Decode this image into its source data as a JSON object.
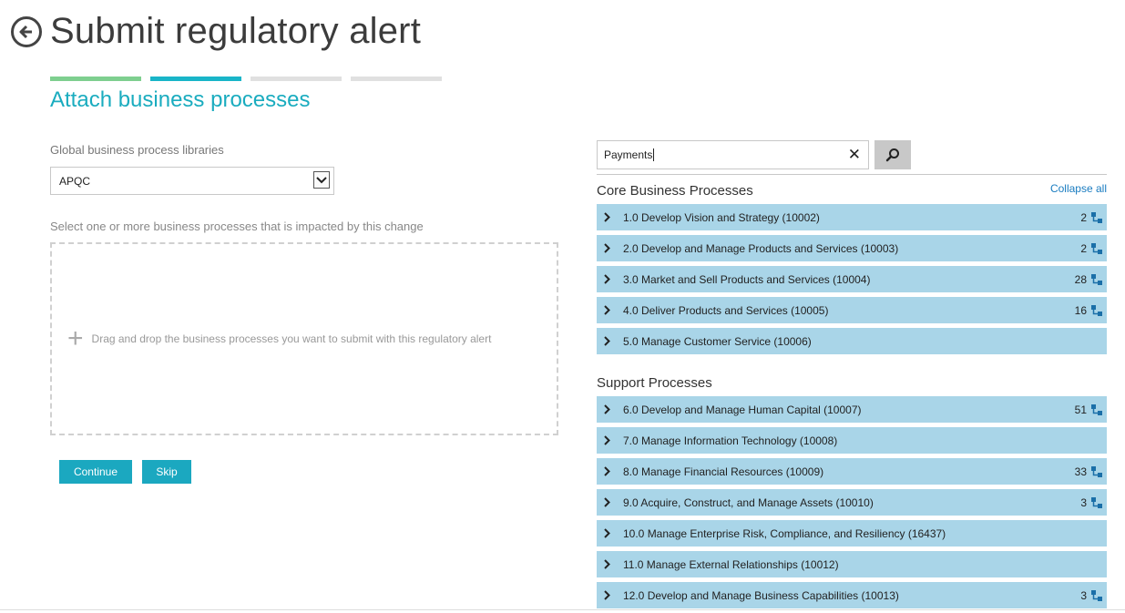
{
  "header": {
    "title": "Submit regulatory alert"
  },
  "wizard": {
    "steps": [
      "done",
      "active",
      "pending",
      "pending"
    ],
    "section_title": "Attach business processes"
  },
  "library": {
    "label": "Global business process libraries",
    "selected": "APQC"
  },
  "selection": {
    "label": "Select one or more business processes that is impacted by this change",
    "drop_text": "Drag and drop the business processes you want to submit with this regulatory alert"
  },
  "buttons": {
    "continue": "Continue",
    "skip": "Skip"
  },
  "search": {
    "value": "Payments"
  },
  "tree": {
    "collapse_all": "Collapse all",
    "groups": [
      {
        "title": "Core Business Processes",
        "items": [
          {
            "label": "1.0 Develop Vision and Strategy (10002)",
            "count": "2"
          },
          {
            "label": "2.0 Develop and Manage Products and Services (10003)",
            "count": "2"
          },
          {
            "label": "3.0 Market and Sell Products and Services (10004)",
            "count": "28"
          },
          {
            "label": "4.0 Deliver Products and Services (10005)",
            "count": "16"
          },
          {
            "label": "5.0 Manage Customer Service (10006)",
            "count": ""
          }
        ]
      },
      {
        "title": "Support Processes",
        "items": [
          {
            "label": "6.0 Develop and Manage Human Capital (10007)",
            "count": "51"
          },
          {
            "label": "7.0 Manage Information Technology (10008)",
            "count": ""
          },
          {
            "label": "8.0 Manage Financial Resources (10009)",
            "count": "33"
          },
          {
            "label": "9.0 Acquire, Construct, and Manage Assets (10010)",
            "count": "3"
          },
          {
            "label": "10.0 Manage Enterprise Risk, Compliance, and Resiliency (16437)",
            "count": ""
          },
          {
            "label": "11.0 Manage External Relationships (10012)",
            "count": ""
          },
          {
            "label": "12.0 Develop and Manage Business Capabilities (10013)",
            "count": "3"
          }
        ]
      }
    ]
  },
  "colors": {
    "accent": "#1ba8c0",
    "row_bg": "#a9d5e8",
    "step_done": "#7ecf8f",
    "step_active": "#19b5c8",
    "hier_icon": "#1a6fa8"
  }
}
